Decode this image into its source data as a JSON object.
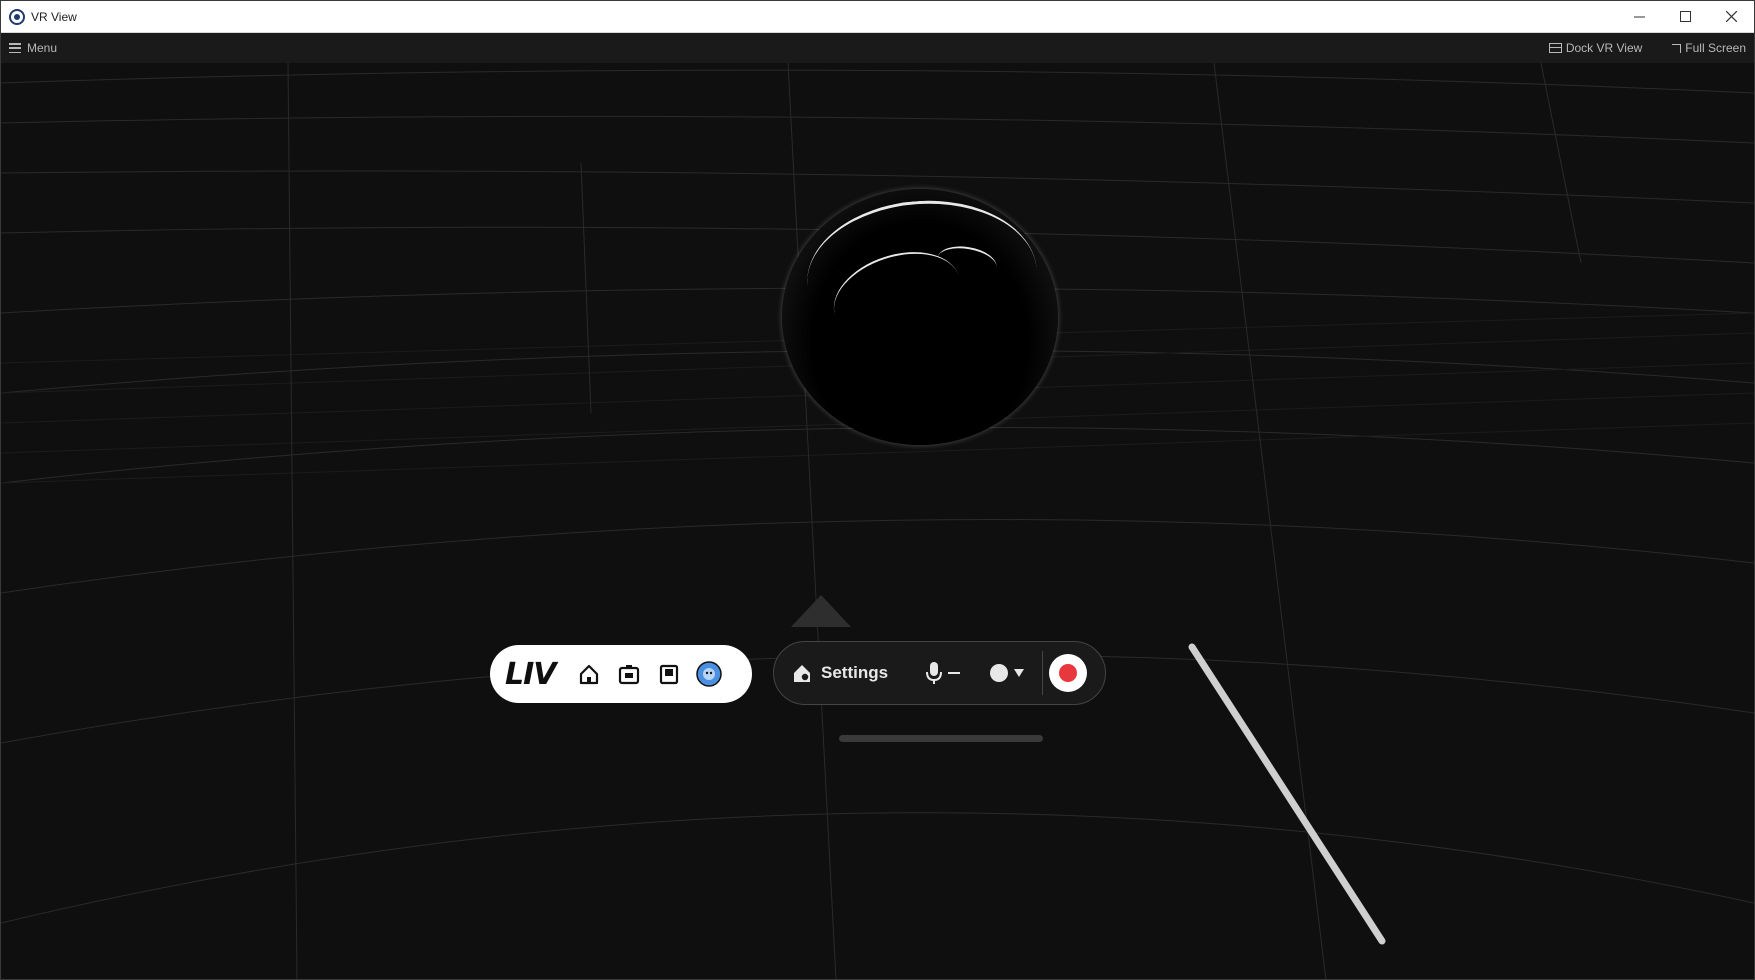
{
  "window": {
    "title": "VR View",
    "controls": {
      "minimize_icon": "minimize-icon",
      "maximize_icon": "maximize-icon",
      "close_icon": "close-icon"
    }
  },
  "menubar": {
    "menu_label": "Menu",
    "dock_label": "Dock VR View",
    "fullscreen_label": "Full Screen"
  },
  "toolbar": {
    "brand": "LIV",
    "icons": [
      "home-icon",
      "camera-icon",
      "book-icon",
      "avatar-icon"
    ],
    "settings_label": "Settings",
    "mic_icon": "mic-icon",
    "record_icon": "record-icon"
  },
  "colors": {
    "record": "#e8383d",
    "background": "#0f0f0f"
  }
}
